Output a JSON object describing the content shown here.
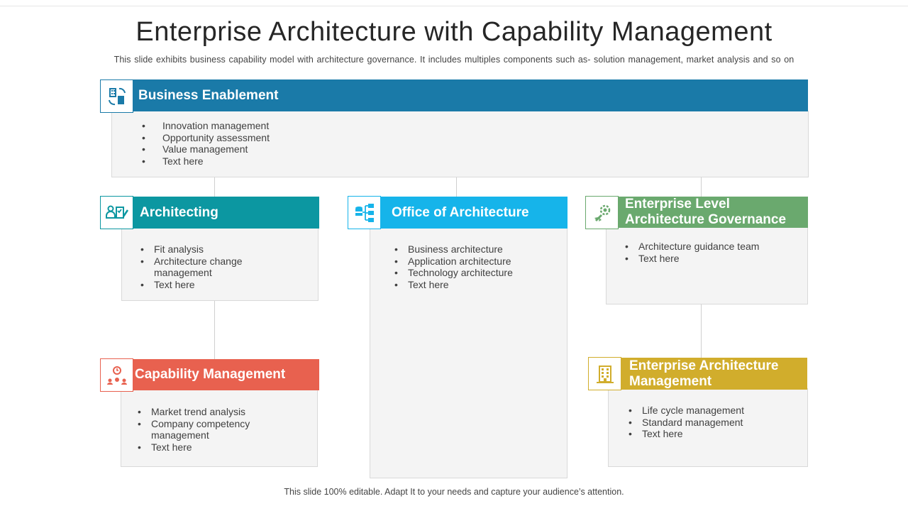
{
  "title": "Enterprise Architecture with Capability Management",
  "subtitle": "This slide exhibits business capability model  with architecture governance.  It includes multiples components such as- solution management, market analysis and so on",
  "footer": "This slide 100% editable. Adapt  It to your needs and capture your audience’s attention.",
  "colors": {
    "business_enablement": "#1a7aa8",
    "architecting": "#0c97a1",
    "office_of_architecture": "#16b4ea",
    "governance": "#6aa96e",
    "capability_management": "#e8614f",
    "ea_management": "#d1ad2c"
  },
  "sections": {
    "business_enablement": {
      "title": "Business Enablement",
      "icon": "building-exchange-icon",
      "items": [
        "Innovation management",
        "Opportunity assessment",
        "Value management",
        "Text here"
      ]
    },
    "architecting": {
      "title": "Architecting",
      "icon": "team-checklist-icon",
      "items": [
        "Fit analysis",
        "Architecture change management",
        "Text here"
      ]
    },
    "office_of_architecture": {
      "title": "Office of Architecture",
      "icon": "database-hierarchy-icon",
      "items": [
        "Business architecture",
        "Application architecture",
        "Technology architecture",
        "Text here"
      ]
    },
    "governance": {
      "title": "Enterprise Level Architecture Governance",
      "icon": "rocket-gear-icon",
      "items": [
        "Architecture guidance team",
        "Text here"
      ]
    },
    "capability_management": {
      "title": "Capability Management",
      "icon": "clock-people-gear-icon",
      "items": [
        "Market trend analysis",
        "Company competency management",
        "Text here"
      ]
    },
    "ea_management": {
      "title": "Enterprise Architecture Management",
      "icon": "office-building-icon",
      "items": [
        "Life cycle management",
        "Standard management",
        "Text here"
      ]
    }
  }
}
